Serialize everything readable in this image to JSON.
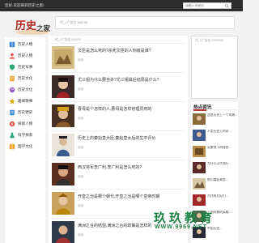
{
  "topbar": {
    "welcome": "您好,欢迎来到历史之家!",
    "search_placeholder": "请输入关键词"
  },
  "logo": {
    "text": "历史之家"
  },
  "ads": {
    "top": "代_1广告位 665*60",
    "middle": "代_1广告位 600*50",
    "side": "代_1广告位 270*200"
  },
  "sidebar": {
    "items": [
      {
        "label": "历史人物",
        "icon": "book-icon"
      },
      {
        "label": "历史人物",
        "icon": "person-icon"
      },
      {
        "label": "历史军事",
        "icon": "shield-icon"
      },
      {
        "label": "历史文化",
        "icon": "scroll-icon"
      },
      {
        "label": "历史文化",
        "icon": "palette-icon"
      },
      {
        "label": "趣闻轶事",
        "icon": "star-icon"
      },
      {
        "label": "历史野史",
        "icon": "scroll-icon"
      },
      {
        "label": "探索人物",
        "icon": "compass-icon"
      },
      {
        "label": "科学探索",
        "icon": "flask-icon"
      },
      {
        "label": "国学文化",
        "icon": "book-icon"
      }
    ]
  },
  "articles": [
    {
      "title": "文臣是怎么死的?杀死文臣的人到底是谁?",
      "meta": "阅读"
    },
    {
      "title": "尤三姐为什么要自杀?尤三姐最后结局是什么?",
      "meta": "阅读"
    },
    {
      "title": "曹母是个怎样的人,曹母是怎样管理贾府的",
      "meta": "阅读"
    },
    {
      "title": "历史上的秦始皇大臣,秦始皇太后的生平评价",
      "meta": "阅读"
    },
    {
      "title": "西汉将军李广利,李广利是怎么死的?",
      "meta": "阅读"
    },
    {
      "title": "开皇之治是哪个朝代,开皇之治是哪个皇帝时期",
      "meta": "阅读"
    },
    {
      "title": "满洲之合的结盟,满洲之合的政策是怎样的",
      "meta": "阅读"
    }
  ],
  "hot": {
    "title": "热点资讯",
    "items": [
      {
        "title": "这是历史上一个叫做..."
      },
      {
        "title": "人类历史上的奇..."
      },
      {
        "title": "吴蒙地下的秘密..."
      },
      {
        "title": "为什么汉代流行..."
      },
      {
        "title": "他们看起来是..."
      },
      {
        "title": "古代的后妃们..."
      },
      {
        "title": "三国时期的英雄..."
      },
      {
        "title": "中国历史..."
      }
    ]
  },
  "watermark": {
    "title": "玖玖教育",
    "domain": "WWW.9969.NET"
  }
}
